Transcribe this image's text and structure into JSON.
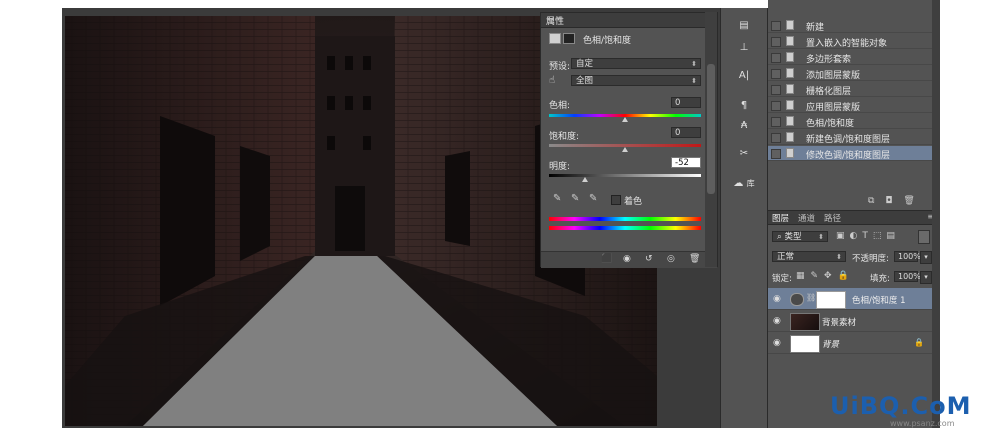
{
  "properties_panel": {
    "title": "属性",
    "adjustment_name": "色相/饱和度",
    "preset_label": "预设:",
    "preset_value": "自定",
    "channel_value": "全图",
    "hue_label": "色相:",
    "hue_value": "0",
    "hue_fraction": 0.5,
    "saturation_label": "饱和度:",
    "saturation_value": "0",
    "saturation_fraction": 0.5,
    "lightness_label": "明度:",
    "lightness_value": "-52",
    "lightness_fraction": 0.24,
    "colorize_label": "着色"
  },
  "history_panel": {
    "items": [
      {
        "label": "新建",
        "active": false
      },
      {
        "label": "置入嵌入的智能对象",
        "active": false
      },
      {
        "label": "多边形套索",
        "active": false
      },
      {
        "label": "添加图层蒙版",
        "active": false
      },
      {
        "label": "栅格化图层",
        "active": false
      },
      {
        "label": "应用图层蒙版",
        "active": false
      },
      {
        "label": "色相/饱和度",
        "active": false
      },
      {
        "label": "新建色调/饱和度图层",
        "active": false
      },
      {
        "label": "修改色调/饱和度图层",
        "active": true
      }
    ]
  },
  "layers_panel": {
    "tabs": [
      "图层",
      "通道",
      "路径"
    ],
    "filter_label": "类型",
    "blend_mode": "正常",
    "opacity_label": "不透明度:",
    "opacity_value": "100%",
    "lock_label": "锁定:",
    "fill_label": "填充:",
    "fill_value": "100%",
    "layers": [
      {
        "name": "色相/饱和度 1",
        "active": true
      },
      {
        "name": "背景素材",
        "active": false
      },
      {
        "name": "背景",
        "active": false
      }
    ]
  },
  "toolbar": {
    "lib_label": "库"
  },
  "watermark": {
    "logo": "UiBQ.CoM",
    "url": "www.psanz.com"
  },
  "colors": {
    "panel_bg": "#535353",
    "panel_dark": "#3d3d3d",
    "selection": "#6e7f98",
    "watermark": "#1c5fae"
  }
}
